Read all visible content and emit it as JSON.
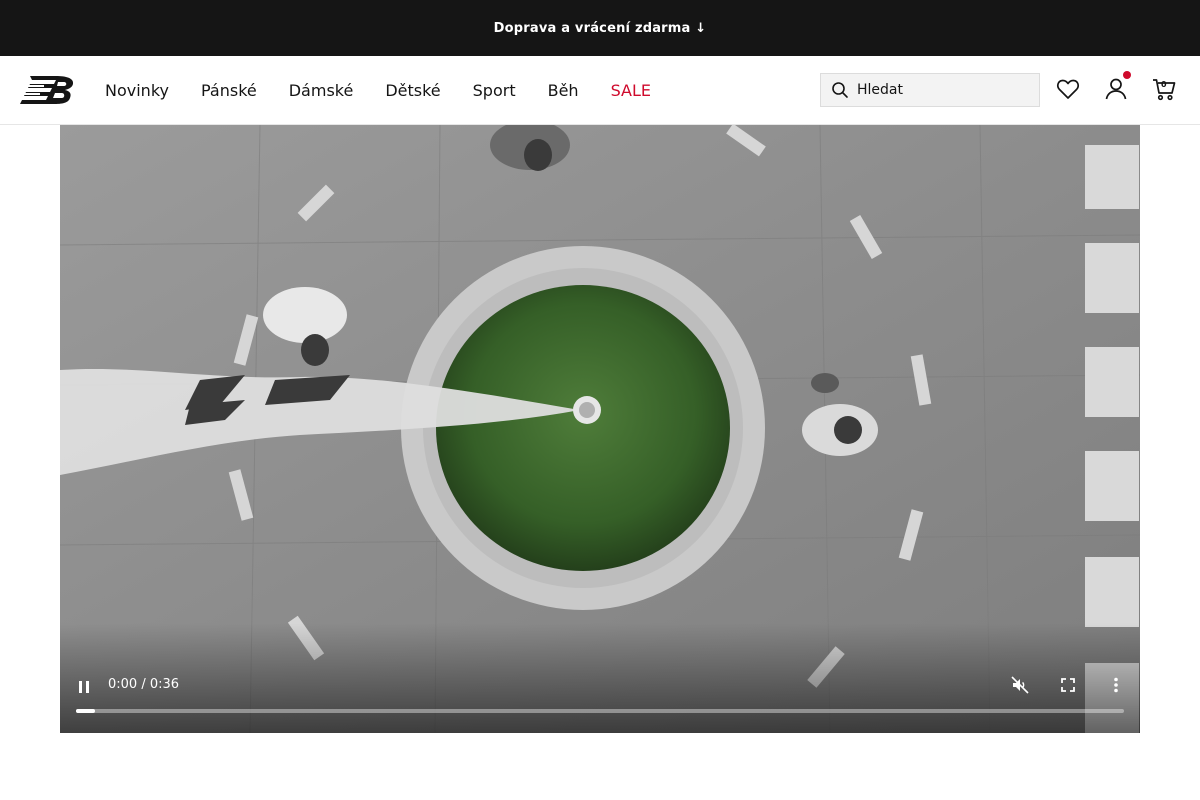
{
  "promo": {
    "text": "Doprava a vrácení zdarma ↓"
  },
  "header": {
    "logo_icon": "new-balance-logo",
    "nav": [
      {
        "label": "Novinky"
      },
      {
        "label": "Pánské"
      },
      {
        "label": "Dámské"
      },
      {
        "label": "Dětské"
      },
      {
        "label": "Sport"
      },
      {
        "label": "Běh"
      },
      {
        "label": "SALE",
        "color": "#cf0a2c"
      }
    ],
    "search": {
      "placeholder": "Hledat",
      "icon": "search-icon"
    },
    "icons": {
      "wishlist": "heart-icon",
      "account": "user-icon",
      "cart": "cart-icon"
    },
    "cart_count": "0"
  },
  "video": {
    "time_display": "0:00 / 0:36",
    "progress": 0.018,
    "state": "playing",
    "icons": {
      "pause": "pause-icon",
      "mute": "volume-muted-icon",
      "fullscreen": "fullscreen-icon",
      "more": "more-vertical-icon"
    }
  },
  "colors": {
    "promo_bg": "#151515",
    "sale": "#cf0a2c",
    "badge": "#cf0a2c"
  }
}
